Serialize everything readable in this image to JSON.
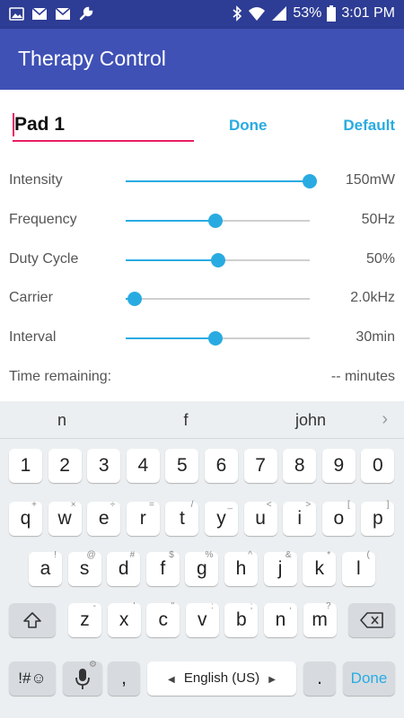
{
  "status_bar": {
    "battery_percent": "53%",
    "time": "3:01 PM",
    "icons": [
      "photo-icon",
      "mail-icon",
      "mail-icon",
      "wrench-icon",
      "bluetooth-icon",
      "wifi-icon",
      "signal-icon",
      "battery-icon"
    ]
  },
  "app_bar": {
    "title": "Therapy Control"
  },
  "pad": {
    "name": "Pad 1",
    "done_label": "Done",
    "default_label": "Default"
  },
  "settings": [
    {
      "label": "Intensity",
      "value": "150mW",
      "level": 1.0
    },
    {
      "label": "Frequency",
      "value": "50Hz",
      "level": 0.49
    },
    {
      "label": "Duty Cycle",
      "value": "50%",
      "level": 0.5
    },
    {
      "label": "Carrier",
      "value": "2.0kHz",
      "level": 0.05
    },
    {
      "label": "Interval",
      "value": "30min",
      "level": 0.49
    }
  ],
  "time_remaining": {
    "label": "Time remaining:",
    "value": "-- minutes"
  },
  "keyboard": {
    "suggestions": [
      "n",
      "f",
      "john"
    ],
    "number_row": [
      "1",
      "2",
      "3",
      "4",
      "5",
      "6",
      "7",
      "8",
      "9",
      "0"
    ],
    "row1": [
      {
        "k": "q",
        "s": "+"
      },
      {
        "k": "w",
        "s": "×"
      },
      {
        "k": "e",
        "s": "÷"
      },
      {
        "k": "r",
        "s": "="
      },
      {
        "k": "t",
        "s": "/"
      },
      {
        "k": "y",
        "s": "_"
      },
      {
        "k": "u",
        "s": "<"
      },
      {
        "k": "i",
        "s": ">"
      },
      {
        "k": "o",
        "s": "["
      },
      {
        "k": "p",
        "s": "]"
      }
    ],
    "row2": [
      {
        "k": "a",
        "s": "!"
      },
      {
        "k": "s",
        "s": "@"
      },
      {
        "k": "d",
        "s": "#"
      },
      {
        "k": "f",
        "s": "$"
      },
      {
        "k": "g",
        "s": "%"
      },
      {
        "k": "h",
        "s": "^"
      },
      {
        "k": "j",
        "s": "&"
      },
      {
        "k": "k",
        "s": "*"
      },
      {
        "k": "l",
        "s": "("
      }
    ],
    "row3": [
      {
        "k": "z",
        "s": "-"
      },
      {
        "k": "x",
        "s": "'"
      },
      {
        "k": "c",
        "s": "\""
      },
      {
        "k": "v",
        "s": ":"
      },
      {
        "k": "b",
        "s": ";"
      },
      {
        "k": "n",
        "s": ","
      },
      {
        "k": "m",
        "s": "?"
      }
    ],
    "symbols_label": "!#☺",
    "comma_label": ",",
    "space_label": "English (US)",
    "period_label": ".",
    "done_label": "Done",
    "accent_color": "#29abe2"
  },
  "colors": {
    "app_bar": "#3f51b5",
    "status_bar": "#2d3c94",
    "field_underline": "#e91e63",
    "accent": "#29abe2"
  }
}
